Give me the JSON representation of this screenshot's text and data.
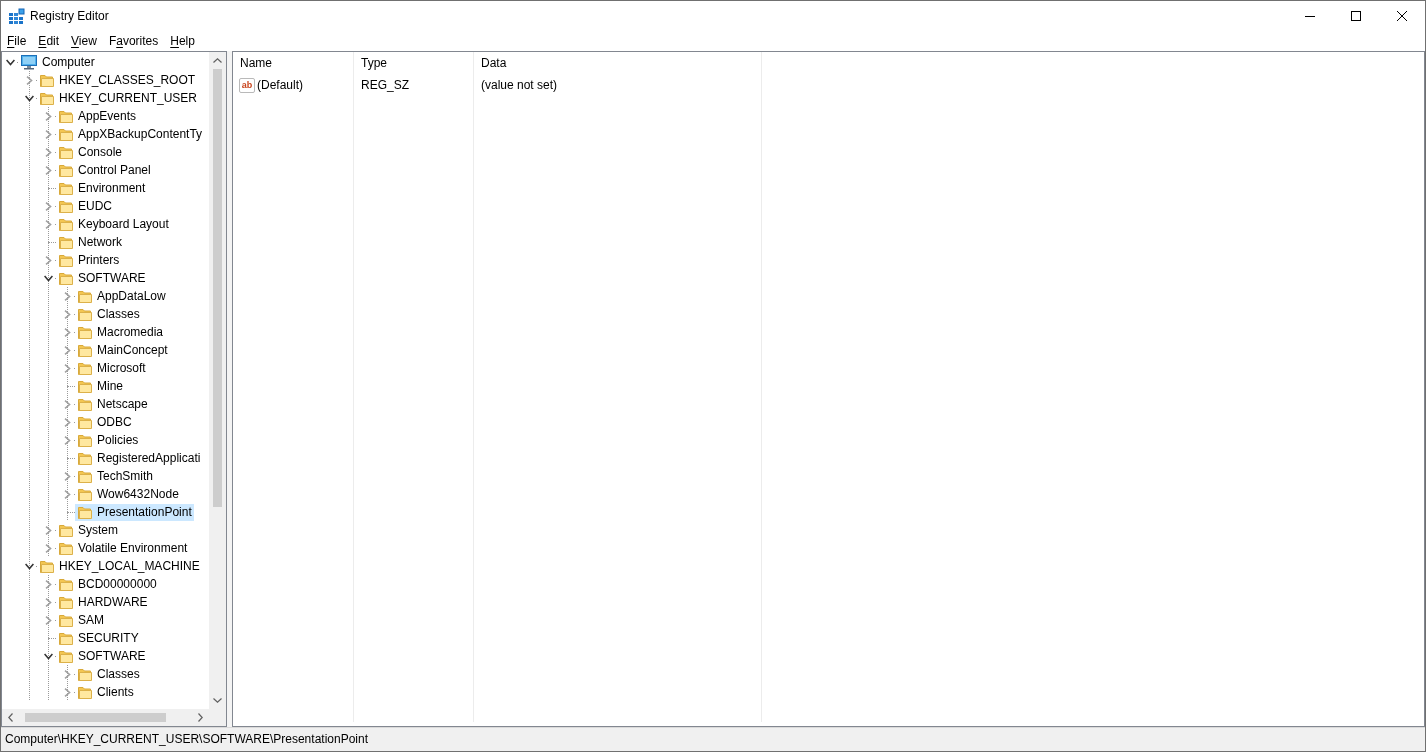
{
  "window": {
    "title": "Registry Editor"
  },
  "menu": [
    {
      "parts": [
        {
          "text": "F",
          "underlined": true
        },
        {
          "text": "ile",
          "underlined": false
        }
      ]
    },
    {
      "parts": [
        {
          "text": "E",
          "underlined": true
        },
        {
          "text": "dit",
          "underlined": false
        }
      ]
    },
    {
      "parts": [
        {
          "text": "V",
          "underlined": true
        },
        {
          "text": "iew",
          "underlined": false
        }
      ]
    },
    {
      "parts": [
        {
          "text": "F",
          "underlined": false
        },
        {
          "text": "a",
          "underlined": true
        },
        {
          "text": "vorites",
          "underlined": false
        }
      ]
    },
    {
      "parts": [
        {
          "text": "H",
          "underlined": true
        },
        {
          "text": "elp",
          "underlined": false
        }
      ]
    }
  ],
  "tree": [
    {
      "label": "Computer",
      "expandable": true,
      "expanded": true,
      "selected": false,
      "children": [
        {
          "label": "HKEY_CLASSES_ROOT",
          "expandable": true,
          "expanded": false,
          "selected": false
        },
        {
          "label": "HKEY_CURRENT_USER",
          "expandable": true,
          "expanded": true,
          "selected": false,
          "children": [
            {
              "label": "AppEvents",
              "expandable": true,
              "expanded": false,
              "selected": false
            },
            {
              "label": "AppXBackupContentTy",
              "expandable": true,
              "expanded": false,
              "selected": false
            },
            {
              "label": "Console",
              "expandable": true,
              "expanded": false,
              "selected": false
            },
            {
              "label": "Control Panel",
              "expandable": true,
              "expanded": false,
              "selected": false
            },
            {
              "label": "Environment",
              "expandable": false,
              "selected": false
            },
            {
              "label": "EUDC",
              "expandable": true,
              "expanded": false,
              "selected": false
            },
            {
              "label": "Keyboard Layout",
              "expandable": true,
              "expanded": false,
              "selected": false
            },
            {
              "label": "Network",
              "expandable": false,
              "selected": false
            },
            {
              "label": "Printers",
              "expandable": true,
              "expanded": false,
              "selected": false
            },
            {
              "label": "SOFTWARE",
              "expandable": true,
              "expanded": true,
              "selected": false,
              "children": [
                {
                  "label": "AppDataLow",
                  "expandable": true,
                  "expanded": false,
                  "selected": false
                },
                {
                  "label": "Classes",
                  "expandable": true,
                  "expanded": false,
                  "selected": false
                },
                {
                  "label": "Macromedia",
                  "expandable": true,
                  "expanded": false,
                  "selected": false
                },
                {
                  "label": "MainConcept",
                  "expandable": true,
                  "expanded": false,
                  "selected": false
                },
                {
                  "label": "Microsoft",
                  "expandable": true,
                  "expanded": false,
                  "selected": false
                },
                {
                  "label": "Mine",
                  "expandable": false,
                  "selected": false
                },
                {
                  "label": "Netscape",
                  "expandable": true,
                  "expanded": false,
                  "selected": false
                },
                {
                  "label": "ODBC",
                  "expandable": true,
                  "expanded": false,
                  "selected": false
                },
                {
                  "label": "Policies",
                  "expandable": true,
                  "expanded": false,
                  "selected": false
                },
                {
                  "label": "RegisteredApplicati",
                  "expandable": false,
                  "selected": false
                },
                {
                  "label": "TechSmith",
                  "expandable": true,
                  "expanded": false,
                  "selected": false
                },
                {
                  "label": "Wow6432Node",
                  "expandable": true,
                  "expanded": false,
                  "selected": false
                },
                {
                  "label": "PresentationPoint",
                  "expandable": false,
                  "selected": true
                }
              ]
            },
            {
              "label": "System",
              "expandable": true,
              "expanded": false,
              "selected": false
            },
            {
              "label": "Volatile Environment",
              "expandable": true,
              "expanded": false,
              "selected": false
            }
          ]
        },
        {
          "label": "HKEY_LOCAL_MACHINE",
          "expandable": true,
          "expanded": true,
          "selected": false,
          "children": [
            {
              "label": "BCD00000000",
              "expandable": true,
              "expanded": false,
              "selected": false
            },
            {
              "label": "HARDWARE",
              "expandable": true,
              "expanded": false,
              "selected": false
            },
            {
              "label": "SAM",
              "expandable": true,
              "expanded": false,
              "selected": false
            },
            {
              "label": "SECURITY",
              "expandable": false,
              "selected": false
            },
            {
              "label": "SOFTWARE",
              "expandable": true,
              "expanded": true,
              "selected": false,
              "children": [
                {
                  "label": "Classes",
                  "expandable": true,
                  "expanded": false,
                  "selected": false
                },
                {
                  "label": "Clients",
                  "expandable": true,
                  "expanded": false,
                  "selected": false
                }
              ]
            }
          ]
        }
      ]
    }
  ],
  "values": {
    "columns": [
      "Name",
      "Type",
      "Data"
    ],
    "rows": [
      {
        "icon_text": "ab",
        "name": "(Default)",
        "type": "REG_SZ",
        "data": "(value not set)",
        "selected": false
      }
    ]
  },
  "status_bar": "Computer\\HKEY_CURRENT_USER\\SOFTWARE\\PresentationPoint"
}
